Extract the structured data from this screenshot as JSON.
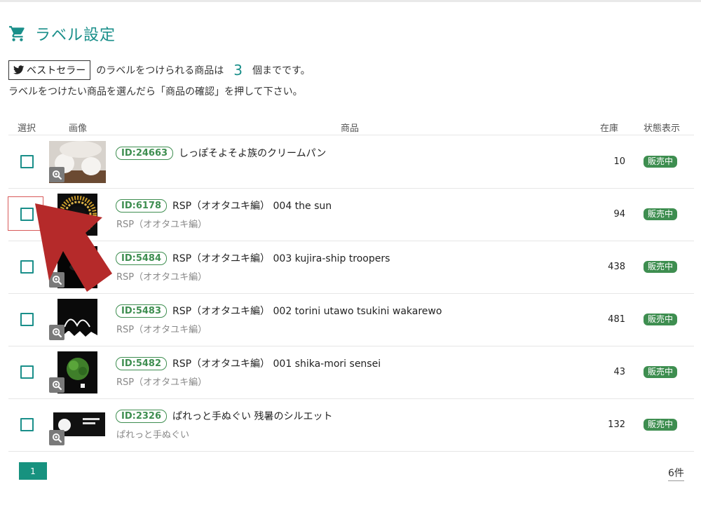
{
  "page": {
    "title": "ラベル設定"
  },
  "info": {
    "label_name": "ベストセラー",
    "limit_text_before": "のラベルをつけられる商品は",
    "limit_number": "3",
    "limit_text_after": "個までです。",
    "instruction": "ラベルをつけたい商品を選んだら「商品の確認」を押して下さい。"
  },
  "table": {
    "headers": {
      "select": "選択",
      "image": "画像",
      "product": "商品",
      "stock": "在庫",
      "status": "状態表示"
    },
    "rows": [
      {
        "id": "ID:24663",
        "name": "しっぽそよそよ族のクリームパン",
        "maker": "",
        "stock": "10",
        "status": "販売中"
      },
      {
        "id": "ID:6178",
        "name": "RSP（オオタユキ編） 004 the sun",
        "maker": "RSP（オオタユキ編）",
        "stock": "94",
        "status": "販売中"
      },
      {
        "id": "ID:5484",
        "name": "RSP（オオタユキ編） 003 kujira-ship troopers",
        "maker": "RSP（オオタユキ編）",
        "stock": "438",
        "status": "販売中"
      },
      {
        "id": "ID:5483",
        "name": "RSP（オオタユキ編） 002 torini utawo tsukini wakarewo",
        "maker": "RSP（オオタユキ編）",
        "stock": "481",
        "status": "販売中"
      },
      {
        "id": "ID:5482",
        "name": "RSP（オオタユキ編） 001 shika-mori sensei",
        "maker": "RSP（オオタユキ編）",
        "stock": "43",
        "status": "販売中"
      },
      {
        "id": "ID:2326",
        "name": "ぱれっと手ぬぐい 残暑のシルエット",
        "maker": "ぱれっと手ぬぐい",
        "stock": "132",
        "status": "販売中"
      }
    ]
  },
  "pagination": {
    "current_page": "1",
    "total_count": "6件"
  },
  "colors": {
    "accent": "#1a8f8a",
    "status_green": "#3e8e50",
    "arrow_red": "#b52a2a"
  }
}
